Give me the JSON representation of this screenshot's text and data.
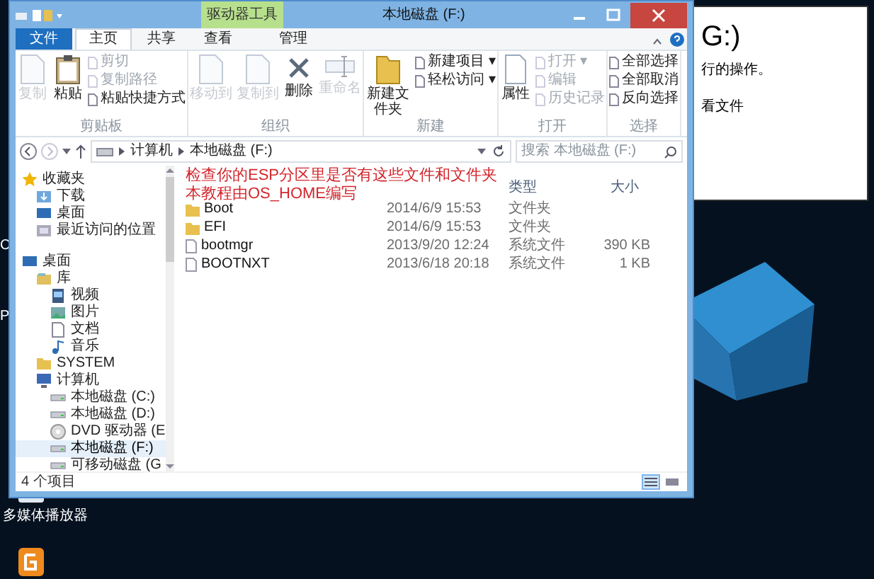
{
  "window": {
    "title": "本地磁盘 (F:)",
    "context_tab": "驱动器工具"
  },
  "ribbon_tabs": [
    {
      "label": "文件",
      "kind": "file",
      "selected": false
    },
    {
      "label": "主页",
      "kind": "tab",
      "selected": true
    },
    {
      "label": "共享",
      "kind": "tab",
      "selected": false
    },
    {
      "label": "查看",
      "kind": "tab",
      "selected": false
    },
    {
      "label": "管理",
      "kind": "context",
      "selected": false
    }
  ],
  "ribbon_groups": [
    {
      "label": "剪贴板",
      "large": [
        {
          "label": "复制",
          "kind": "document",
          "disabled": true
        },
        {
          "label": "粘贴",
          "kind": "clipboard",
          "disabled": false
        }
      ],
      "small": [
        {
          "label": "剪切",
          "disabled": true
        },
        {
          "label": "复制路径",
          "disabled": true
        },
        {
          "label": "粘贴快捷方式",
          "disabled": false
        }
      ]
    },
    {
      "label": "组织",
      "large": [
        {
          "label": "移动到",
          "kind": "document",
          "disabled": true
        },
        {
          "label": "复制到",
          "kind": "document",
          "disabled": true
        },
        {
          "label": "删除",
          "kind": "delete",
          "disabled": false
        },
        {
          "label": "重命名",
          "kind": "rename",
          "disabled": true
        }
      ]
    },
    {
      "label": "新建",
      "large": [
        {
          "label": "新建文件夹",
          "kind": "folder",
          "disabled": false
        }
      ],
      "small": [
        {
          "label": "新建项目 ▾",
          "disabled": false
        },
        {
          "label": "轻松访问 ▾",
          "disabled": false
        }
      ]
    },
    {
      "label": "打开",
      "large": [
        {
          "label": "属性",
          "kind": "properties",
          "disabled": false
        }
      ],
      "small": [
        {
          "label": "打开 ▾",
          "disabled": true
        },
        {
          "label": "编辑",
          "disabled": true
        },
        {
          "label": "历史记录",
          "disabled": true
        }
      ]
    },
    {
      "label": "选择",
      "small": [
        {
          "label": "全部选择",
          "disabled": false
        },
        {
          "label": "全部取消",
          "disabled": false
        },
        {
          "label": "反向选择",
          "disabled": false
        }
      ]
    }
  ],
  "address": {
    "crumbs": [
      "计算机",
      "本地磁盘 (F:)"
    ],
    "search_placeholder": "搜索 本地磁盘 (F:)"
  },
  "nav": [
    {
      "label": "收藏夹",
      "kind": "star",
      "selected": false,
      "children": [
        {
          "label": "下载",
          "kind": "download",
          "selected": false
        },
        {
          "label": "桌面",
          "kind": "desktop",
          "selected": false
        },
        {
          "label": "最近访问的位置",
          "kind": "recent",
          "selected": false
        }
      ]
    },
    {
      "label": "桌面",
      "kind": "desktop",
      "selected": false,
      "children": [
        {
          "label": "库",
          "kind": "library",
          "selected": false,
          "children": [
            {
              "label": "视频",
              "kind": "video",
              "selected": false
            },
            {
              "label": "图片",
              "kind": "picture",
              "selected": false
            },
            {
              "label": "文档",
              "kind": "document",
              "selected": false
            },
            {
              "label": "音乐",
              "kind": "music",
              "selected": false
            }
          ]
        },
        {
          "label": "SYSTEM",
          "kind": "folder",
          "selected": false
        },
        {
          "label": "计算机",
          "kind": "computer",
          "selected": false,
          "children": [
            {
              "label": "本地磁盘 (C:)",
              "kind": "drive",
              "selected": false
            },
            {
              "label": "本地磁盘 (D:)",
              "kind": "drive",
              "selected": false
            },
            {
              "label": "DVD 驱动器 (E",
              "kind": "dvd",
              "selected": false
            },
            {
              "label": "本地磁盘 (F:)",
              "kind": "drive",
              "selected": true
            },
            {
              "label": "可移动磁盘 (G",
              "kind": "drive",
              "selected": false
            }
          ]
        }
      ]
    }
  ],
  "columns": [
    "类型",
    "大小"
  ],
  "files": [
    {
      "name": "Boot",
      "kind": "folder",
      "date": "2014/6/9 15:53",
      "type": "文件夹"
    },
    {
      "name": "EFI",
      "kind": "folder",
      "date": "2014/6/9 15:53",
      "type": "文件夹"
    },
    {
      "name": "bootmgr",
      "kind": "file",
      "date": "2013/9/20 12:24",
      "type": "系统文件",
      "size": "390 KB"
    },
    {
      "name": "BOOTNXT",
      "kind": "file",
      "date": "2013/6/18 20:18",
      "type": "系统文件",
      "size": "1 KB"
    }
  ],
  "annotation": [
    "检查你的ESP分区里是否有这些文件和文件夹",
    "本教程由OS_HOME编写"
  ],
  "status": {
    "count": "4 个项目",
    "views": [
      {
        "kind": "details",
        "selected": true
      },
      {
        "kind": "tiles",
        "selected": false
      }
    ]
  },
  "background_document": [
    "G:)",
    "行的操作。",
    "看文件"
  ],
  "desktop": {
    "icon_label": "多媒体播放器",
    "edge_letters": [
      "C",
      "P"
    ]
  }
}
